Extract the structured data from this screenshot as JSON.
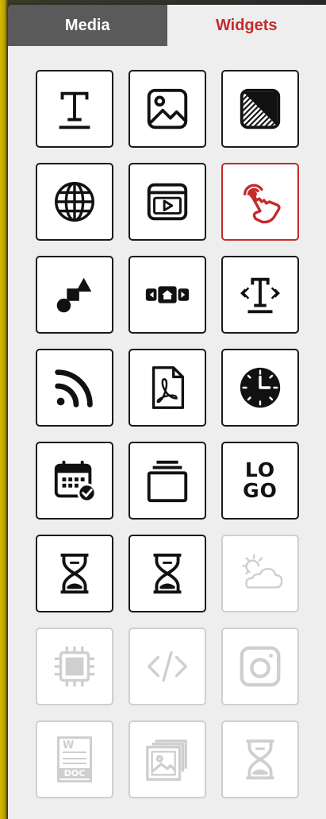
{
  "tabs": {
    "media": "Media",
    "widgets": "Widgets",
    "active": "widgets"
  },
  "colors": {
    "accent": "#c52b2b",
    "tab_inactive_bg": "#5a5a5a",
    "panel_bg": "#eeeeee",
    "tile_border": "#1a1a1a",
    "disabled": "#cfcfcf"
  },
  "widgets": [
    {
      "icon": "text-icon",
      "state": "enabled"
    },
    {
      "icon": "image-icon",
      "state": "enabled"
    },
    {
      "icon": "shape-hatch-icon",
      "state": "enabled"
    },
    {
      "icon": "globe-icon",
      "state": "enabled"
    },
    {
      "icon": "video-player-icon",
      "state": "enabled"
    },
    {
      "icon": "touch-hand-icon",
      "state": "active"
    },
    {
      "icon": "shapes-icon",
      "state": "enabled"
    },
    {
      "icon": "navigation-home-icon",
      "state": "enabled"
    },
    {
      "icon": "text-scroll-icon",
      "state": "enabled"
    },
    {
      "icon": "rss-feed-icon",
      "state": "enabled"
    },
    {
      "icon": "pdf-document-icon",
      "state": "enabled"
    },
    {
      "icon": "clock-icon",
      "state": "enabled"
    },
    {
      "icon": "calendar-check-icon",
      "state": "enabled"
    },
    {
      "icon": "stacked-frames-icon",
      "state": "enabled"
    },
    {
      "icon": "logo-text-icon",
      "state": "enabled",
      "text_line1": "LO",
      "text_line2": "GO"
    },
    {
      "icon": "hourglass-icon",
      "state": "enabled"
    },
    {
      "icon": "hourglass-icon",
      "state": "enabled"
    },
    {
      "icon": "weather-cloud-sun-icon",
      "state": "disabled"
    },
    {
      "icon": "cpu-chip-icon",
      "state": "disabled"
    },
    {
      "icon": "code-brackets-icon",
      "state": "disabled"
    },
    {
      "icon": "instagram-icon",
      "state": "disabled"
    },
    {
      "icon": "word-document-icon",
      "state": "disabled",
      "text_line1": "W",
      "text_line2": "DOC"
    },
    {
      "icon": "image-gallery-icon",
      "state": "disabled"
    },
    {
      "icon": "hourglass-icon",
      "state": "disabled"
    }
  ]
}
